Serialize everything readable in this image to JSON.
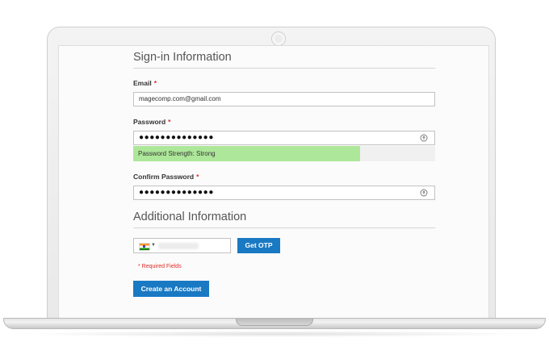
{
  "form": {
    "signin_title": "Sign-in Information",
    "email": {
      "label": "Email",
      "required_mark": "*",
      "value": "magecomp.com@gmail.com"
    },
    "password": {
      "label": "Password",
      "required_mark": "*",
      "value": "●●●●●●●●●●●●●●",
      "strength_text": "Password Strength: Strong",
      "strength_level": 0.75
    },
    "confirm_password": {
      "label": "Confirm Password",
      "required_mark": "*",
      "value": "●●●●●●●●●●●●●●"
    },
    "additional_title": "Additional Information",
    "phone": {
      "country": "India",
      "flag_icon": "india-flag-icon",
      "get_otp_label": "Get OTP"
    },
    "required_fields_note": "* Required Fields",
    "submit_label": "Create an Account"
  },
  "colors": {
    "primary_button": "#1979c3",
    "required": "#e02b27",
    "strength_strong": "#ade79a"
  }
}
